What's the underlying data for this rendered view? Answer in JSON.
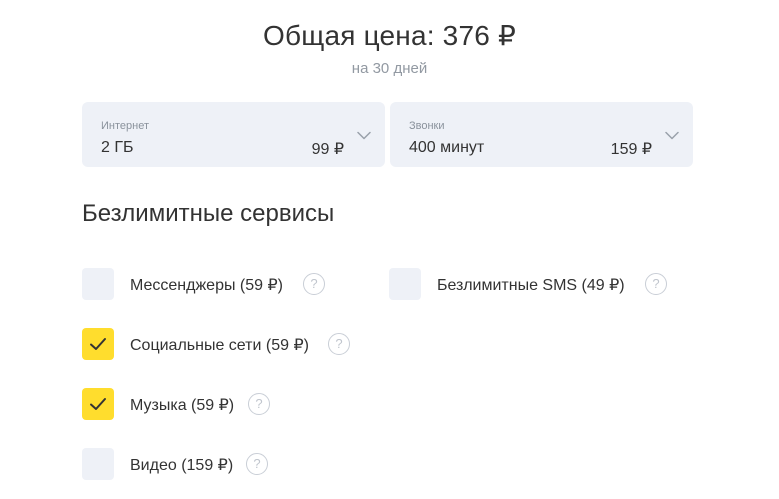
{
  "summary": {
    "total_price": "Общая цена: 376 ₽",
    "period": "на 30 дней"
  },
  "selectors": {
    "internet": {
      "label": "Интернет",
      "value": "2 ГБ",
      "price": "99 ₽"
    },
    "calls": {
      "label": "Звонки",
      "value": "400 минут",
      "price": "159 ₽"
    }
  },
  "services": {
    "title": "Безлимитные сервисы",
    "help_glyph": "?",
    "items": [
      {
        "label": "Мессенджеры (59 ₽)",
        "checked": false
      },
      {
        "label": "Безлимитные SMS (49 ₽)",
        "checked": false
      },
      {
        "label": "Социальные сети (59 ₽)",
        "checked": true
      },
      {
        "label": "Музыка (59 ₽)",
        "checked": true
      },
      {
        "label": "Видео (159 ₽)",
        "checked": false
      }
    ]
  },
  "colors": {
    "accent": "#ffdd2d",
    "field_bg": "#eef1f7",
    "muted_text": "#9299a2"
  },
  "icons": {
    "dropdown": "chevron-down-icon",
    "check": "check-icon",
    "help": "question-circle-icon"
  }
}
